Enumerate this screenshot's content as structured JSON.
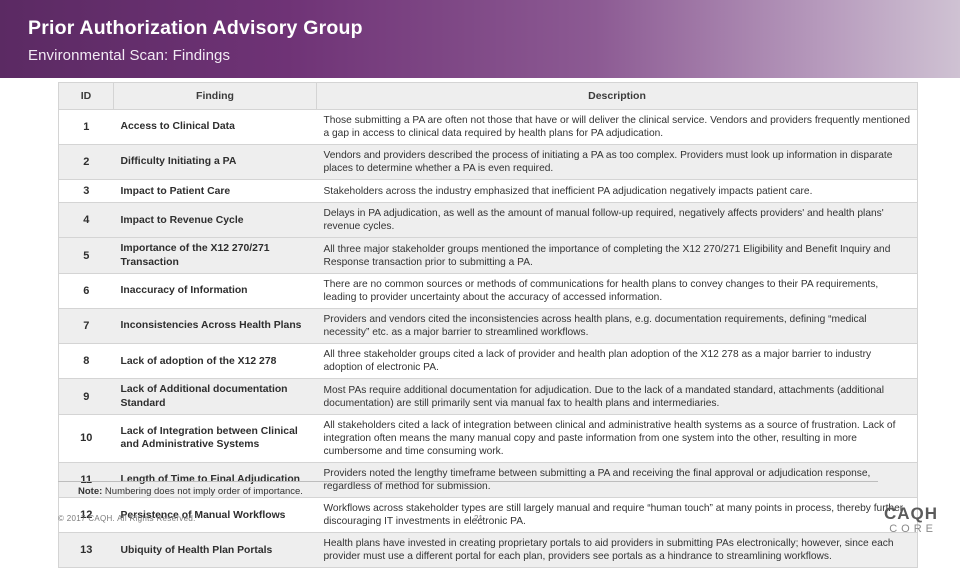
{
  "header": {
    "title": "Prior Authorization Advisory Group",
    "subtitle": "Environmental Scan: Findings"
  },
  "table": {
    "columns": [
      "ID",
      "Finding",
      "Description"
    ],
    "rows": [
      {
        "id": "1",
        "finding": "Access to Clinical Data",
        "description": "Those submitting a PA are often not those that have or will deliver the clinical service. Vendors and providers frequently mentioned a gap in access to clinical data required by health plans for PA adjudication."
      },
      {
        "id": "2",
        "finding": "Difficulty Initiating a PA",
        "description": "Vendors and providers described the process of initiating a PA as too complex. Providers must look up information in disparate places to determine whether a PA is even required."
      },
      {
        "id": "3",
        "finding": "Impact to Patient Care",
        "description": "Stakeholders across the industry emphasized that inefficient PA adjudication negatively impacts patient care."
      },
      {
        "id": "4",
        "finding": "Impact to Revenue Cycle",
        "description": "Delays in PA adjudication, as well as the amount of manual follow-up required, negatively affects providers' and health plans' revenue cycles."
      },
      {
        "id": "5",
        "finding": "Importance of the X12 270/271 Transaction",
        "description": "All three major stakeholder groups mentioned the importance of completing the X12 270/271 Eligibility and Benefit Inquiry and Response transaction prior to submitting a PA."
      },
      {
        "id": "6",
        "finding": "Inaccuracy of Information",
        "description": "There are no common sources or methods of communications for health plans to convey changes to their PA requirements, leading to provider uncertainty about the accuracy of accessed information."
      },
      {
        "id": "7",
        "finding": "Inconsistencies Across Health Plans",
        "description": "Providers and vendors cited the inconsistencies across health plans, e.g. documentation requirements, defining “medical necessity” etc. as a major barrier to streamlined workflows."
      },
      {
        "id": "8",
        "finding": "Lack of adoption of the X12 278",
        "description": "All three stakeholder groups cited a lack of provider and health plan adoption of the X12 278 as a major barrier to industry adoption of electronic PA."
      },
      {
        "id": "9",
        "finding": "Lack of Additional documentation Standard",
        "description": "Most PAs require additional documentation for adjudication. Due to the lack of a mandated standard, attachments (additional documentation) are still primarily sent via manual fax to health plans and intermediaries."
      },
      {
        "id": "10",
        "finding": "Lack of Integration between Clinical and Administrative Systems",
        "description": "All stakeholders cited a lack of integration between clinical and administrative health systems as a source of frustration. Lack of integration often means the many manual copy and paste information from one system into the other, resulting in more cumbersome and time consuming work."
      },
      {
        "id": "11",
        "finding": "Length of Time to Final Adjudication",
        "description": "Providers noted the lengthy timeframe between submitting a PA and receiving the final approval or adjudication response, regardless of method for submission."
      },
      {
        "id": "12",
        "finding": "Persistence of Manual Workflows",
        "description": "Workflows across stakeholder types are still largely manual and require “human touch” at many points in process, thereby further discouraging IT investments in electronic PA."
      },
      {
        "id": "13",
        "finding": "Ubiquity of Health Plan Portals",
        "description": "Health plans have invested in creating proprietary portals to aid providers in submitting PAs electronically; however, since each provider must use a different portal for each plan, providers see portals as a hindrance to streamlining workflows."
      }
    ]
  },
  "footer": {
    "note_label": "Note:",
    "note_text": "Numbering does not imply order of importance.",
    "copyright": "© 2017 CAQH. All Rights Reserved.",
    "page_number": "21",
    "logo_main": "CAQH",
    "logo_sub": "CORE"
  },
  "colors": {
    "header_dark": "#5b2a63",
    "header_light": "#cfc2d3",
    "row_alt": "#eeeeee",
    "border": "#d4d4d4"
  }
}
